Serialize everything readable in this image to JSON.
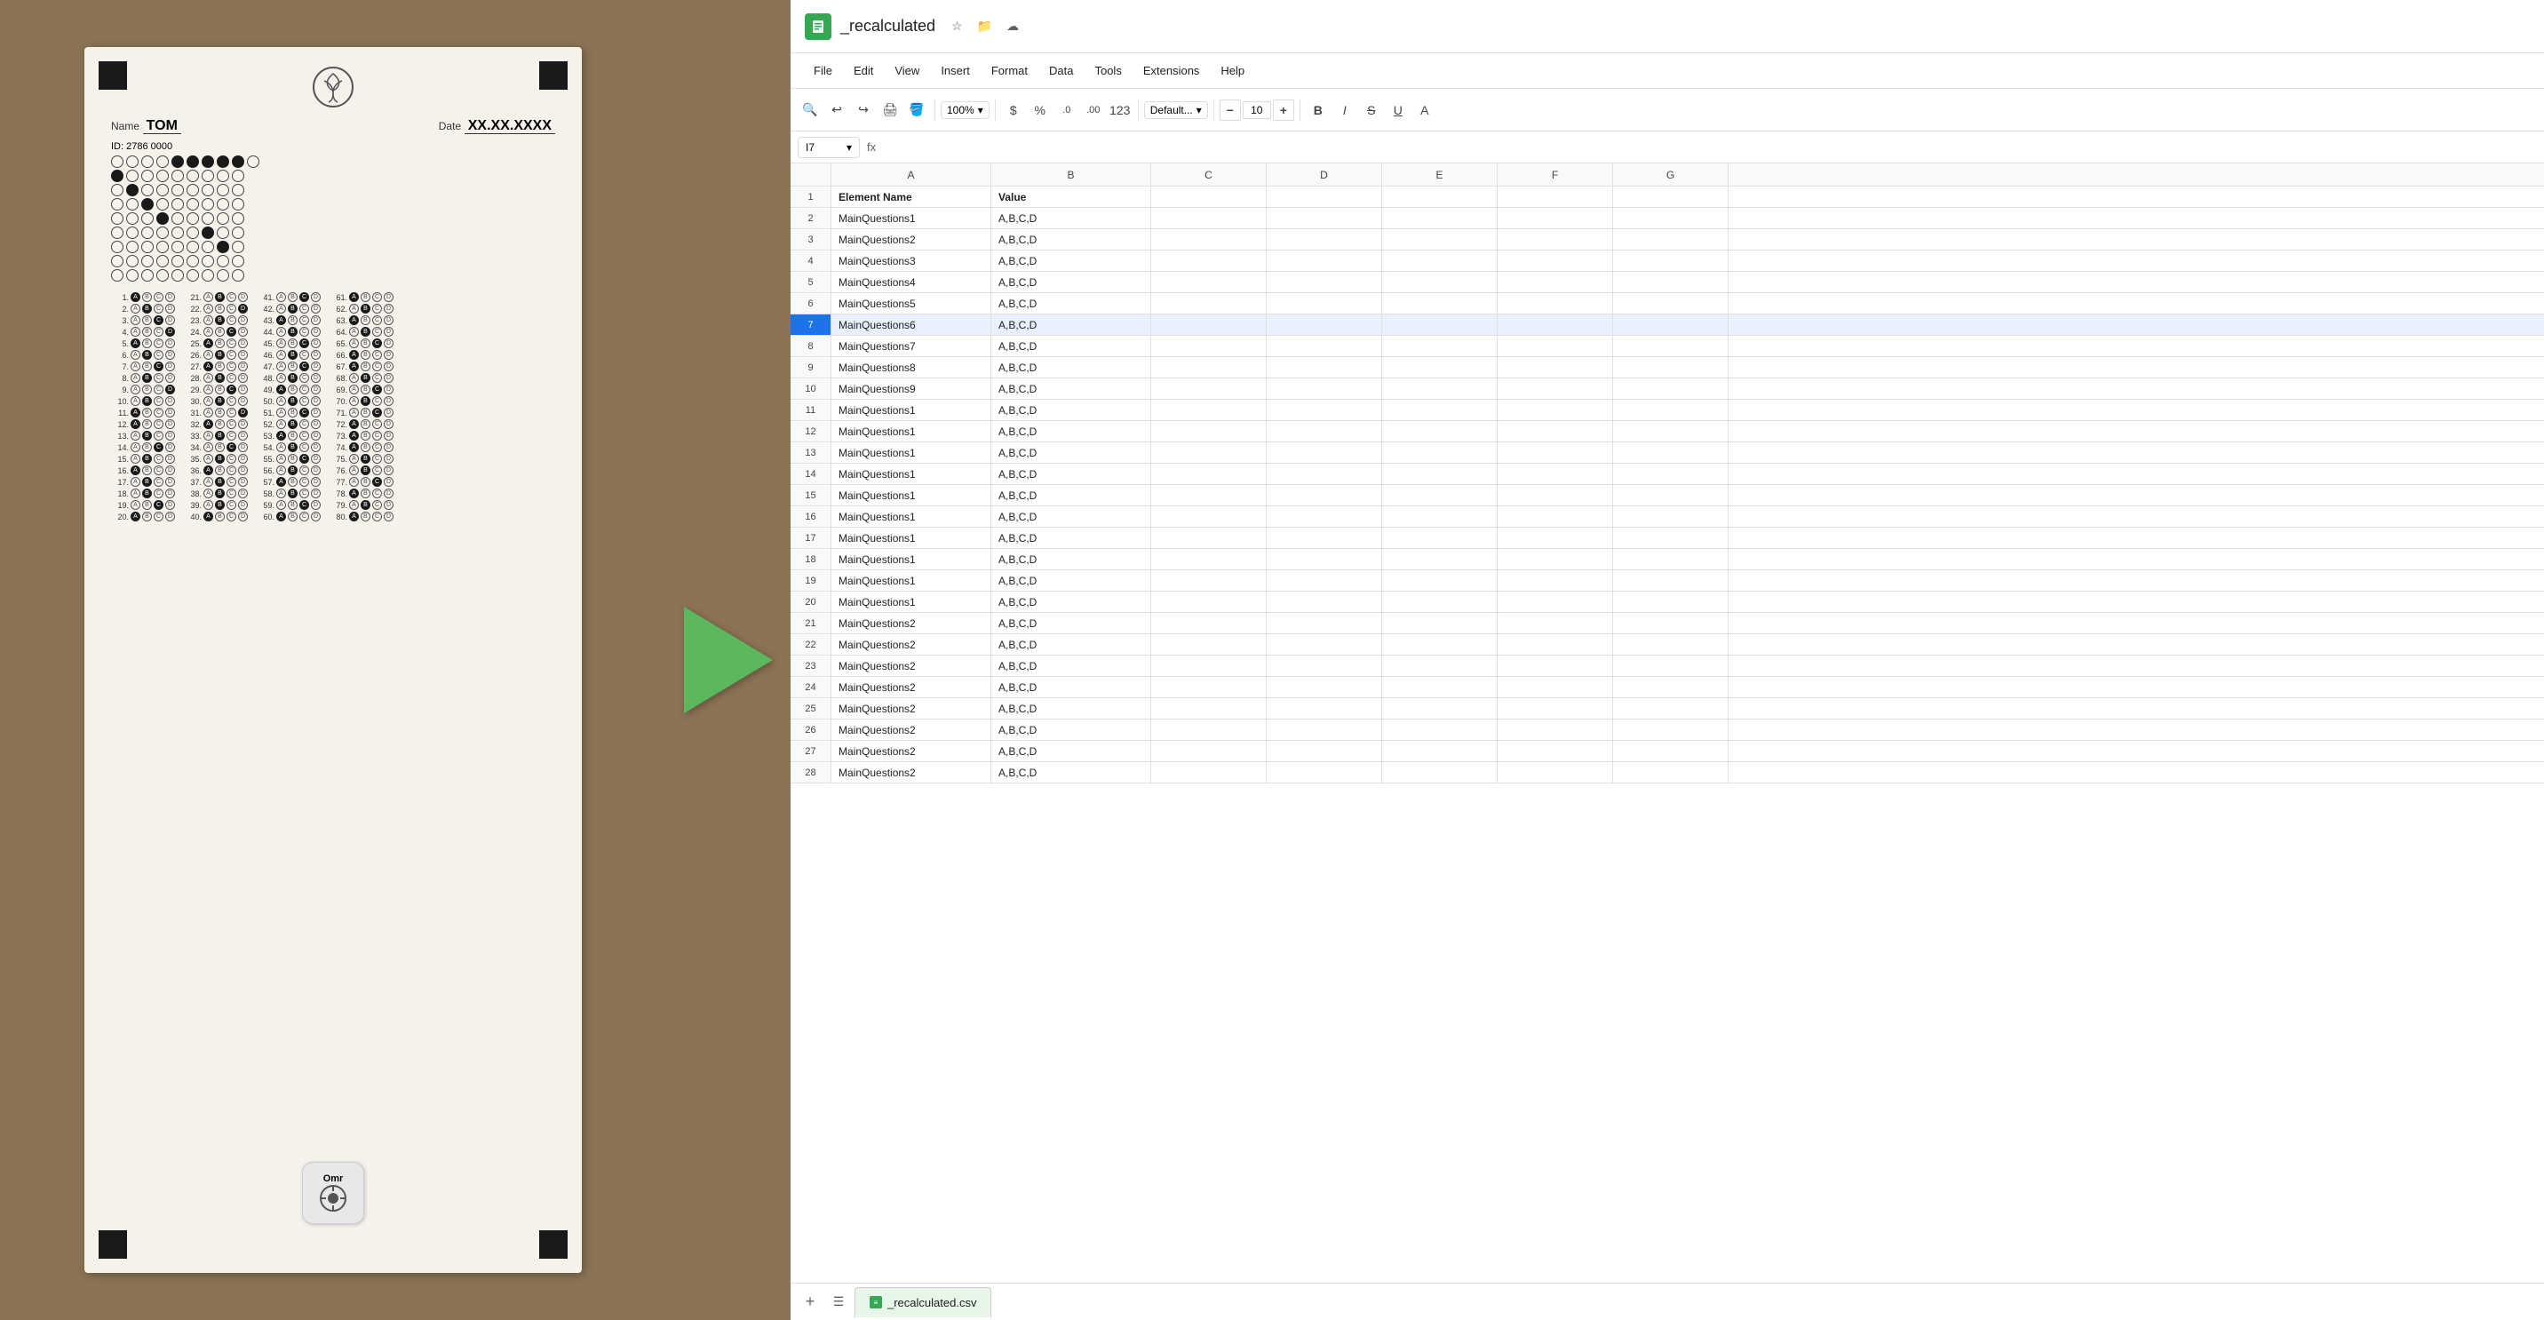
{
  "app": {
    "title": "_recalculated",
    "tab_title": "_recalculated.csv"
  },
  "menu": {
    "items": [
      "File",
      "Edit",
      "View",
      "Insert",
      "Format",
      "Data",
      "Tools",
      "Extensions",
      "Help"
    ]
  },
  "toolbar": {
    "zoom": "100%",
    "font": "Default...",
    "font_size": "10",
    "currency_symbol": "$",
    "percent_symbol": "%",
    "decimal_decrease": ".0",
    "decimal_increase": ".00",
    "number_format": "123",
    "bold": "B",
    "italic": "I",
    "strikethrough": "S",
    "underline": "U"
  },
  "formula_bar": {
    "cell_ref": "I7",
    "fx_symbol": "fx",
    "formula_value": ""
  },
  "columns": {
    "headers": [
      "",
      "A",
      "B",
      "C",
      "D",
      "E",
      "F",
      "G"
    ]
  },
  "rows": [
    {
      "num": 1,
      "A": "Element Name",
      "B": "Value",
      "C": "",
      "D": "",
      "E": "",
      "F": "",
      "G": "",
      "selected": false,
      "bold": true
    },
    {
      "num": 2,
      "A": "MainQuestions1",
      "B": "A,B,C,D",
      "C": "",
      "D": "",
      "E": "",
      "F": "",
      "G": "",
      "selected": false
    },
    {
      "num": 3,
      "A": "MainQuestions2",
      "B": "A,B,C,D",
      "C": "",
      "D": "",
      "E": "",
      "F": "",
      "G": "",
      "selected": false
    },
    {
      "num": 4,
      "A": "MainQuestions3",
      "B": "A,B,C,D",
      "C": "",
      "D": "",
      "E": "",
      "F": "",
      "G": "",
      "selected": false
    },
    {
      "num": 5,
      "A": "MainQuestions4",
      "B": "A,B,C,D",
      "C": "",
      "D": "",
      "E": "",
      "F": "",
      "G": "",
      "selected": false
    },
    {
      "num": 6,
      "A": "MainQuestions5",
      "B": "A,B,C,D",
      "C": "",
      "D": "",
      "E": "",
      "F": "",
      "G": "",
      "selected": false
    },
    {
      "num": 7,
      "A": "MainQuestions6",
      "B": "A,B,C,D",
      "C": "",
      "D": "",
      "E": "",
      "F": "",
      "G": "",
      "selected": true
    },
    {
      "num": 8,
      "A": "MainQuestions7",
      "B": "A,B,C,D",
      "C": "",
      "D": "",
      "E": "",
      "F": "",
      "G": "",
      "selected": false
    },
    {
      "num": 9,
      "A": "MainQuestions8",
      "B": "A,B,C,D",
      "C": "",
      "D": "",
      "E": "",
      "F": "",
      "G": "",
      "selected": false
    },
    {
      "num": 10,
      "A": "MainQuestions9",
      "B": "A,B,C,D",
      "C": "",
      "D": "",
      "E": "",
      "F": "",
      "G": "",
      "selected": false
    },
    {
      "num": 11,
      "A": "MainQuestions1",
      "B": "A,B,C,D",
      "C": "",
      "D": "",
      "E": "",
      "F": "",
      "G": "",
      "selected": false
    },
    {
      "num": 12,
      "A": "MainQuestions1",
      "B": "A,B,C,D",
      "C": "",
      "D": "",
      "E": "",
      "F": "",
      "G": "",
      "selected": false
    },
    {
      "num": 13,
      "A": "MainQuestions1",
      "B": "A,B,C,D",
      "C": "",
      "D": "",
      "E": "",
      "F": "",
      "G": "",
      "selected": false
    },
    {
      "num": 14,
      "A": "MainQuestions1",
      "B": "A,B,C,D",
      "C": "",
      "D": "",
      "E": "",
      "F": "",
      "G": "",
      "selected": false
    },
    {
      "num": 15,
      "A": "MainQuestions1",
      "B": "A,B,C,D",
      "C": "",
      "D": "",
      "E": "",
      "F": "",
      "G": "",
      "selected": false
    },
    {
      "num": 16,
      "A": "MainQuestions1",
      "B": "A,B,C,D",
      "C": "",
      "D": "",
      "E": "",
      "F": "",
      "G": "",
      "selected": false
    },
    {
      "num": 17,
      "A": "MainQuestions1",
      "B": "A,B,C,D",
      "C": "",
      "D": "",
      "E": "",
      "F": "",
      "G": "",
      "selected": false
    },
    {
      "num": 18,
      "A": "MainQuestions1",
      "B": "A,B,C,D",
      "C": "",
      "D": "",
      "E": "",
      "F": "",
      "G": "",
      "selected": false
    },
    {
      "num": 19,
      "A": "MainQuestions1",
      "B": "A,B,C,D",
      "C": "",
      "D": "",
      "E": "",
      "F": "",
      "G": "",
      "selected": false
    },
    {
      "num": 20,
      "A": "MainQuestions1",
      "B": "A,B,C,D",
      "C": "",
      "D": "",
      "E": "",
      "F": "",
      "G": "",
      "selected": false
    },
    {
      "num": 21,
      "A": "MainQuestions2",
      "B": "A,B,C,D",
      "C": "",
      "D": "",
      "E": "",
      "F": "",
      "G": "",
      "selected": false
    },
    {
      "num": 22,
      "A": "MainQuestions2",
      "B": "A,B,C,D",
      "C": "",
      "D": "",
      "E": "",
      "F": "",
      "G": "",
      "selected": false
    },
    {
      "num": 23,
      "A": "MainQuestions2",
      "B": "A,B,C,D",
      "C": "",
      "D": "",
      "E": "",
      "F": "",
      "G": "",
      "selected": false
    },
    {
      "num": 24,
      "A": "MainQuestions2",
      "B": "A,B,C,D",
      "C": "",
      "D": "",
      "E": "",
      "F": "",
      "G": "",
      "selected": false
    },
    {
      "num": 25,
      "A": "MainQuestions2",
      "B": "A,B,C,D",
      "C": "",
      "D": "",
      "E": "",
      "F": "",
      "G": "",
      "selected": false
    },
    {
      "num": 26,
      "A": "MainQuestions2",
      "B": "A,B,C,D",
      "C": "",
      "D": "",
      "E": "",
      "F": "",
      "G": "",
      "selected": false
    },
    {
      "num": 27,
      "A": "MainQuestions2",
      "B": "A,B,C,D",
      "C": "",
      "D": "",
      "E": "",
      "F": "",
      "G": "",
      "selected": false
    },
    {
      "num": 28,
      "A": "MainQuestions2",
      "B": "A,B,C,D",
      "C": "",
      "D": "",
      "E": "",
      "F": "",
      "G": "",
      "selected": false
    }
  ],
  "sheet_tab": {
    "label": "_recalculated.csv"
  },
  "omr": {
    "name": "TOM",
    "date": "XX.XX.XXXX",
    "id_digits": "2786 0000",
    "app_label": "Omr"
  }
}
